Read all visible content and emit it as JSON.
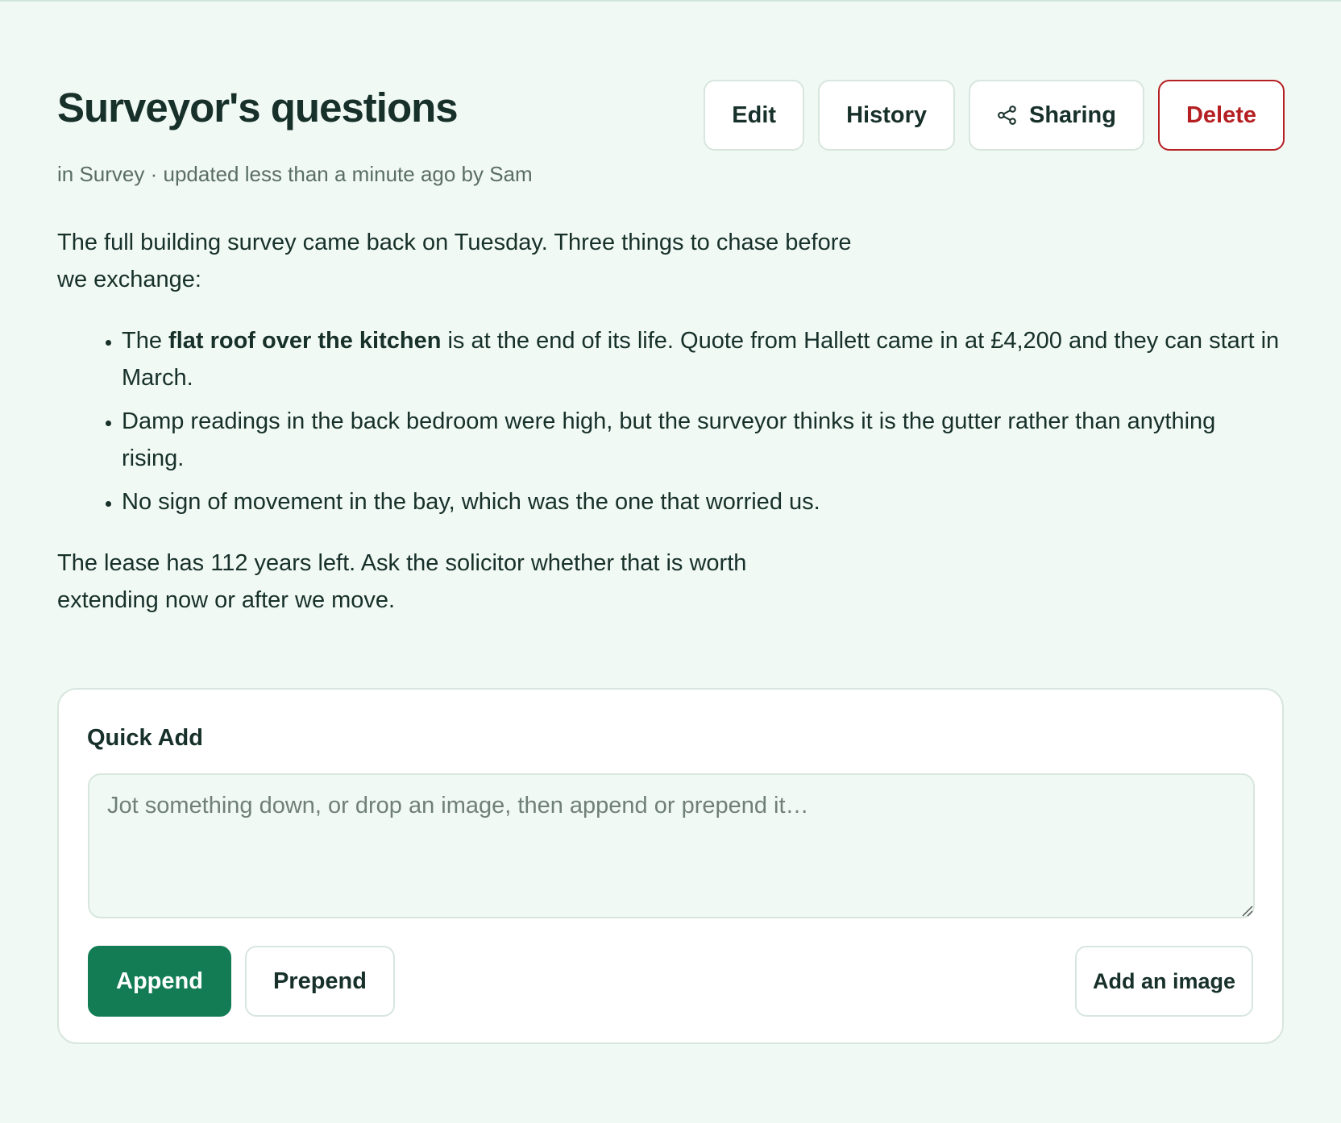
{
  "page": {
    "title": "Surveyor's questions",
    "meta": {
      "prefix": "in ",
      "category": "Survey",
      "separator": " · ",
      "updated": "updated less than a minute ago by Sam"
    }
  },
  "actions": {
    "edit_label": "Edit",
    "history_label": "History",
    "sharing_label": "Sharing",
    "sharing_icon": "share-icon",
    "delete_label": "Delete",
    "delete_color": "#b51f22"
  },
  "content": {
    "intro": "The full building survey came back on Tuesday. Three things to chase before we exchange:",
    "bullets": [
      {
        "prefix": "The ",
        "bold": "flat roof over the kitchen",
        "rest": " is at the end of its life. Quote from Hallett came in at £4,200 and they can start in March."
      },
      {
        "text": "Damp readings in the back bedroom were high, but the surveyor thinks it is the gutter rather than anything rising."
      },
      {
        "text": "No sign of movement in the bay, which was the one that worried us."
      }
    ],
    "closing": "The lease has 112 years left. Ask the solicitor whether that is worth extending now or after we move."
  },
  "quick_add": {
    "title": "Quick Add",
    "placeholder": "Jot something down, or drop an image, then append or prepend it…",
    "value": "",
    "append_label": "Append",
    "prepend_label": "Prepend",
    "add_image_label": "Add an image"
  },
  "colors": {
    "background": "#f1f9f4",
    "primary": "#137c55",
    "danger": "#b51f22",
    "text": "#17302a"
  }
}
